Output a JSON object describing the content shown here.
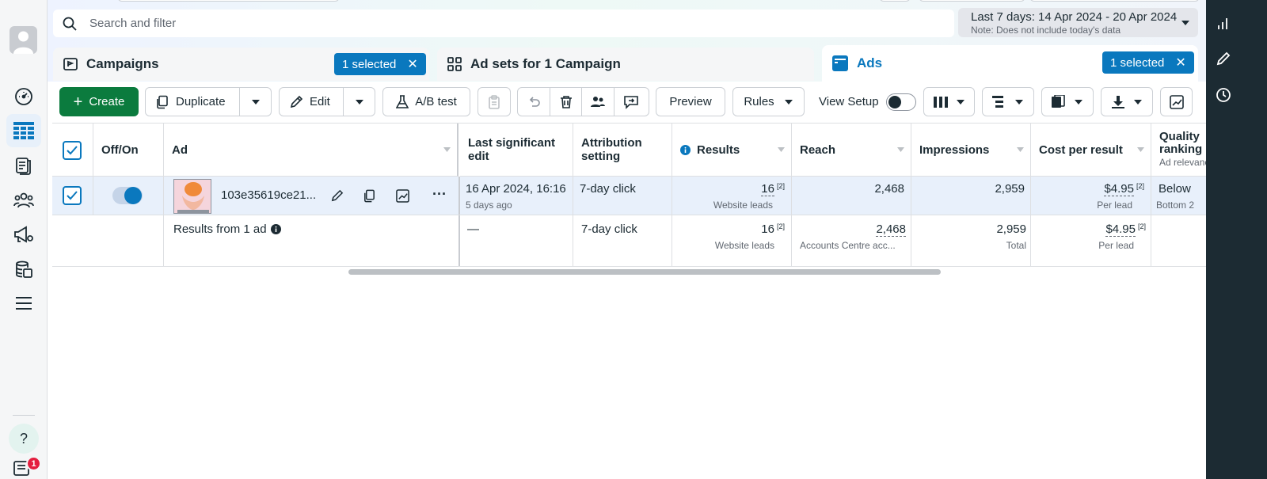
{
  "search": {
    "placeholder": "Search and filter"
  },
  "date_range": {
    "label": "Last 7 days: 14 Apr 2024 - 20 Apr 2024",
    "note": "Note: Does not include today's data"
  },
  "tabs": [
    {
      "label": "Campaigns",
      "selected_label": "1 selected"
    },
    {
      "label": "Ad sets for 1 Campaign"
    },
    {
      "label": "Ads",
      "selected_label": "1 selected"
    }
  ],
  "toolbar": {
    "create": "Create",
    "duplicate": "Duplicate",
    "edit": "Edit",
    "ab_test": "A/B test",
    "preview": "Preview",
    "rules": "Rules",
    "view_setup": "View Setup"
  },
  "columns": {
    "off_on": "Off/On",
    "ad": "Ad",
    "last_edit": "Last significant edit",
    "attribution": "Attribution setting",
    "results": "Results",
    "reach": "Reach",
    "impressions": "Impressions",
    "cost_per_result": "Cost per result",
    "quality": "Quality ranking",
    "quality_sub": "Ad relevance"
  },
  "rows": [
    {
      "ad_name": "103e35619ce21...",
      "last_edit": "16 Apr 2024, 16:16",
      "last_edit_sub": "5 days ago",
      "attribution": "7-day click",
      "results": "16",
      "results_sup": "[2]",
      "results_sub": "Website leads",
      "reach": "2,468",
      "impressions": "2,959",
      "cost": "$4.95",
      "cost_sup": "[2]",
      "cost_sub": "Per lead",
      "quality": "Below",
      "quality_sub": "Bottom 2"
    }
  ],
  "summary": {
    "label": "Results from 1 ad",
    "last_edit": "—",
    "attribution": "7-day click",
    "results": "16",
    "results_sup": "[2]",
    "results_sub": "Website leads",
    "reach": "2,468",
    "reach_sub": "Accounts Centre acc...",
    "impressions": "2,959",
    "impressions_sub": "Total",
    "cost": "$4.95",
    "cost_sup": "[2]",
    "cost_sub": "Per lead"
  },
  "notifications": {
    "count": "1"
  },
  "help": {
    "label": "?"
  },
  "icons": {
    "search": "search-icon",
    "campaign": "flag-icon",
    "adsets": "grid-icon",
    "ads": "ad-icon",
    "info": "info-icon"
  },
  "colors": {
    "primary": "#0b7b3e",
    "accent": "#0a78be",
    "selected_row": "#e8f0fb",
    "rail": "#1c2b33"
  }
}
